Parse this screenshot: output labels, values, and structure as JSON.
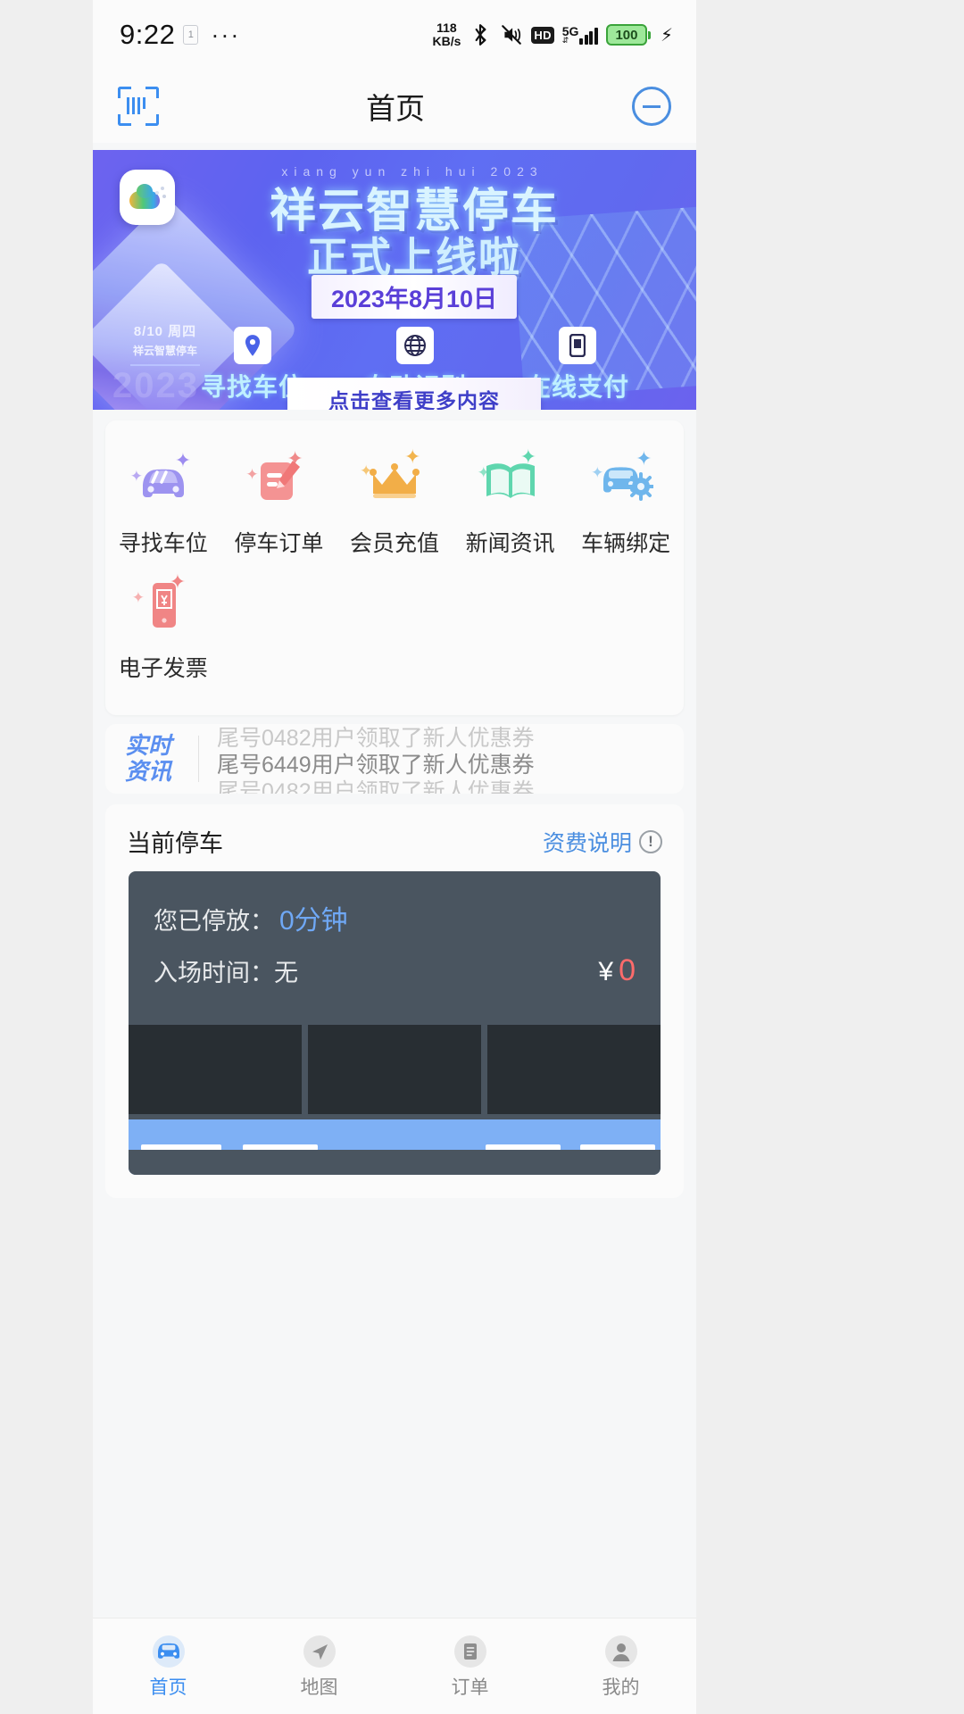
{
  "status_bar": {
    "time": "9:22",
    "net_badge": "1",
    "menu_dots": "···",
    "speed_value": "118",
    "speed_unit": "KB/s",
    "hd_label": "HD",
    "network_type": "5G",
    "battery_level": "100",
    "icons": [
      "bluetooth-icon",
      "mute-icon",
      "hd-icon",
      "signal-icon",
      "battery-icon",
      "charging-bolt-icon"
    ]
  },
  "header": {
    "title": "首页",
    "scan_icon": "scan-qr-icon",
    "message_icon": "message-icon"
  },
  "banner": {
    "pinyin": "xiang yun zhi hui 2023",
    "title_line1": "祥云智慧停车",
    "title_line2": "正式上线啦",
    "date_badge": "2023年8月10日",
    "corner_date": "8/10  周四",
    "corner_sub": "祥云智慧停车",
    "watermark_year": "2023",
    "features": [
      {
        "label": "寻找车位",
        "icon": "location-pin-icon"
      },
      {
        "label": "自动识别",
        "icon": "globe-icon"
      },
      {
        "label": "在线支付",
        "icon": "mobile-phone-icon"
      }
    ],
    "cta": "点击查看更多内容"
  },
  "menu": {
    "items": [
      {
        "label": "寻找车位",
        "icon": "car-icon",
        "color": "#9d93f0"
      },
      {
        "label": "停车订单",
        "icon": "order-edit-icon",
        "color": "#f08a8a"
      },
      {
        "label": "会员充值",
        "icon": "crown-icon",
        "color": "#f2ae48"
      },
      {
        "label": "新闻资讯",
        "icon": "book-icon",
        "color": "#5fd6ae"
      },
      {
        "label": "车辆绑定",
        "icon": "car-settings-icon",
        "color": "#6fb6ec"
      },
      {
        "label": "电子发票",
        "icon": "e-invoice-icon",
        "color": "#f08585"
      }
    ]
  },
  "ticker": {
    "label_line1": "实时",
    "label_line2": "资讯",
    "messages": [
      "尾号0482用户领取了新人优惠券",
      "尾号6449用户领取了新人优惠券",
      "尾号0482用户领取了新人优惠券"
    ]
  },
  "parking": {
    "section_title": "当前停车",
    "fee_link": "资费说明",
    "info_icon": "info-icon",
    "duration_label": "您已停放：",
    "duration_value": "0分钟",
    "entry_label": "入场时间：",
    "entry_value": "无",
    "currency_symbol": "¥",
    "amount": "0"
  },
  "tabbar": {
    "items": [
      {
        "label": "首页",
        "icon": "car-home-icon",
        "active": true
      },
      {
        "label": "地图",
        "icon": "navigation-icon",
        "active": false
      },
      {
        "label": "订单",
        "icon": "order-list-icon",
        "active": false
      },
      {
        "label": "我的",
        "icon": "person-icon",
        "active": false
      }
    ]
  },
  "colors": {
    "accent": "#3c8ef0",
    "banner_purple": "#6063f0",
    "amount_red": "#ff6b6b",
    "lot_gray": "#4a5560"
  }
}
